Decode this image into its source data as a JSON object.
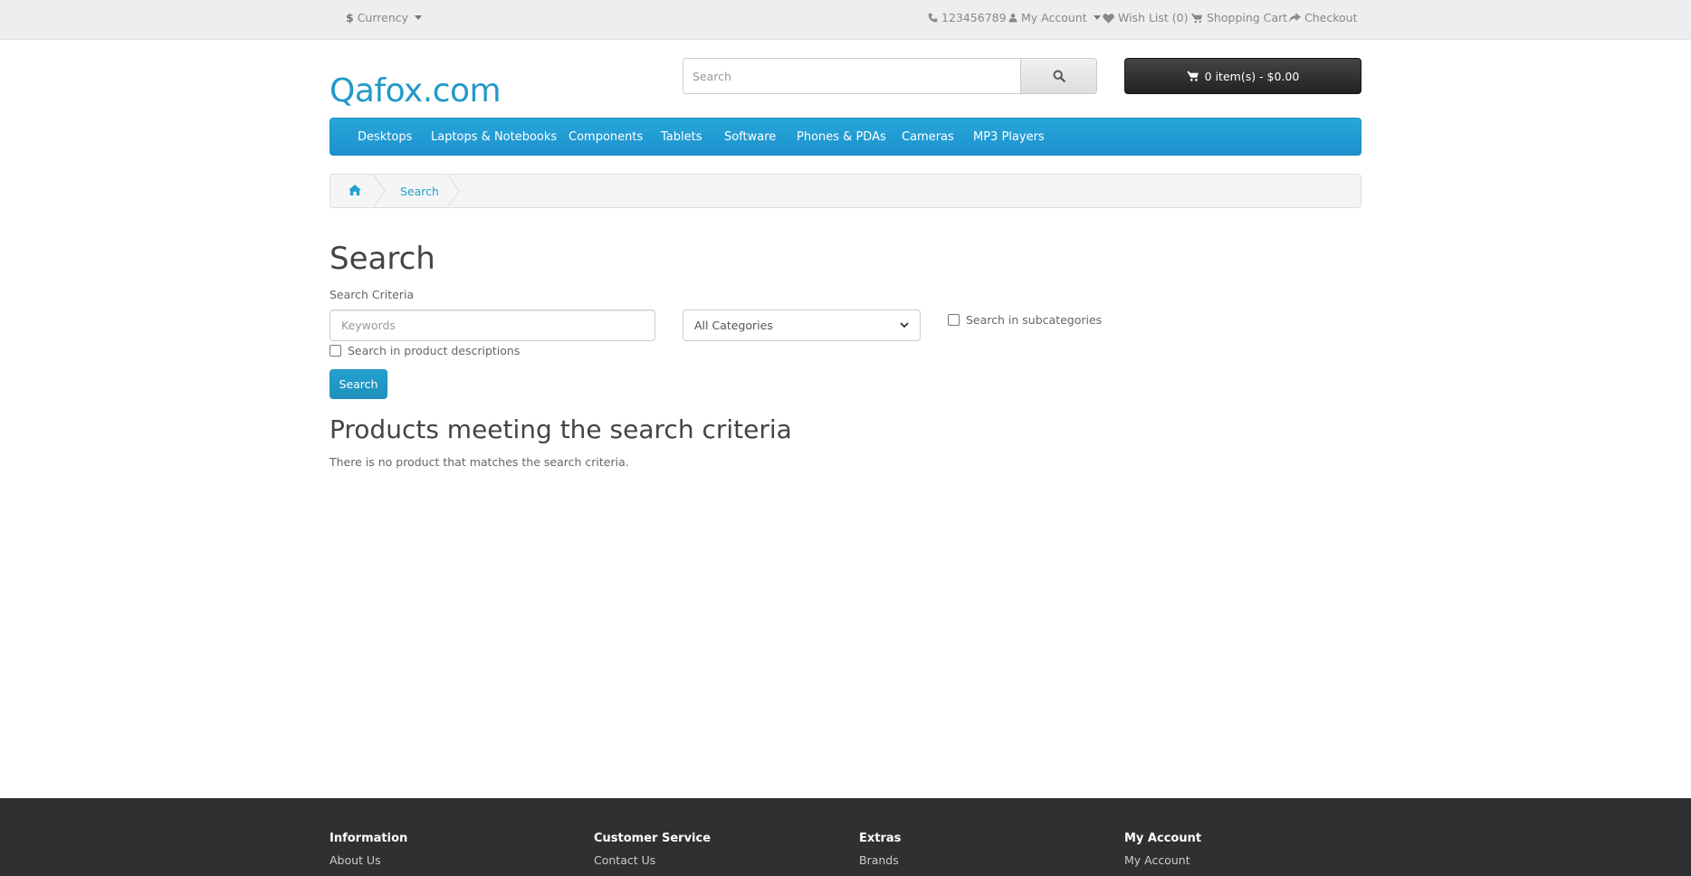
{
  "topbar": {
    "currency_symbol": "$",
    "currency_label": "Currency",
    "phone": "123456789",
    "my_account": "My Account",
    "wishlist": "Wish List (0)",
    "shopping_cart": "Shopping Cart",
    "checkout": "Checkout"
  },
  "header": {
    "logo": "Qafox.com",
    "search_placeholder": "Search",
    "cart_label": "0 item(s) - $0.00"
  },
  "menu": {
    "items": [
      "Desktops",
      "Laptops & Notebooks",
      "Components",
      "Tablets",
      "Software",
      "Phones & PDAs",
      "Cameras",
      "MP3 Players"
    ]
  },
  "breadcrumb": {
    "current": "Search"
  },
  "main": {
    "title": "Search",
    "criteria_label": "Search Criteria",
    "keywords_placeholder": "Keywords",
    "category_selected": "All Categories",
    "subcategories_label": "Search in subcategories",
    "descriptions_label": "Search in product descriptions",
    "search_button": "Search",
    "results_title": "Products meeting the search criteria",
    "no_results": "There is no product that matches the search criteria."
  },
  "footer": {
    "columns": [
      {
        "title": "Information",
        "link": "About Us"
      },
      {
        "title": "Customer Service",
        "link": "Contact Us"
      },
      {
        "title": "Extras",
        "link": "Brands"
      },
      {
        "title": "My Account",
        "link": "My Account"
      }
    ]
  },
  "colors": {
    "accent": "#229ac8",
    "menu_bg": "#1e91cf",
    "cart_bg": "#303030",
    "footer_bg": "#303030"
  },
  "icons": {
    "currency": "dollar-icon",
    "phone": "phone-icon",
    "account": "user-icon",
    "wishlist": "heart-icon",
    "cart": "shopping-cart-icon",
    "checkout": "share-icon",
    "search": "search-icon",
    "home": "home-icon"
  }
}
